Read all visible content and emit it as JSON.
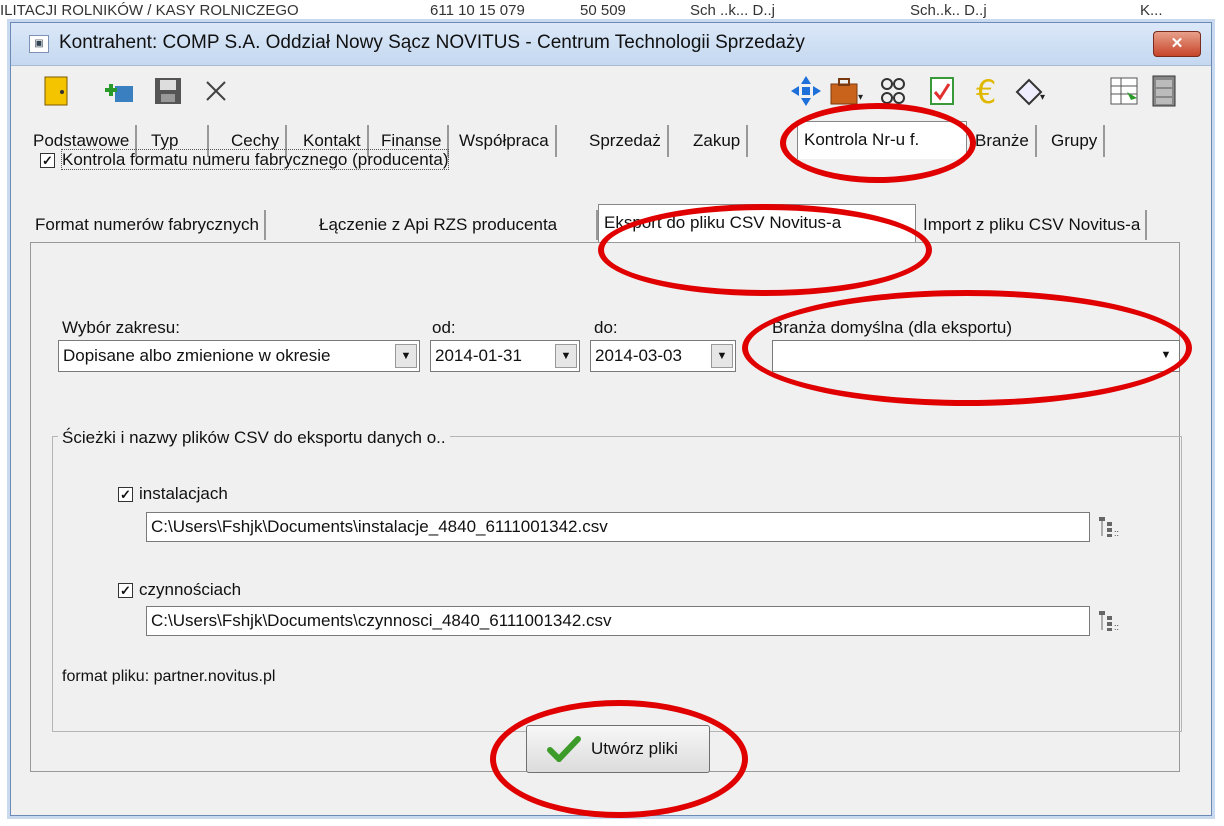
{
  "background": {
    "top_text": [
      "ILITACJI ROLNIKÓW / KASY ROLNICZEGO",
      "611 10 15 079",
      "50 509",
      "Sch ..k... D..j",
      "Sch..k.. D..j",
      "K..."
    ]
  },
  "window": {
    "title": "Kontrahent: COMP S.A. Oddział Nowy Sącz NOVITUS - Centrum Technologii Sprzedaży",
    "close_label": "✕"
  },
  "main_tabs": [
    "Podstawowe",
    "Typ",
    "Cechy",
    "Kontakt",
    "Finanse",
    "Współpraca",
    "Sprzedaż",
    "Zakup",
    "Kontrola Nr-u f.",
    "Branże",
    "Grupy"
  ],
  "active_main_tab": "Kontrola Nr-u f.",
  "format_check": {
    "checked": true,
    "label": "Kontrola formatu numeru fabrycznego (producenta)"
  },
  "sub_tabs": [
    "Format numerów fabrycznych",
    "Łączenie z Api RZS producenta",
    "Eksport do pliku CSV Novitus-a",
    "Import z pliku CSV Novitus-a"
  ],
  "active_sub_tab": "Eksport do pliku CSV Novitus-a",
  "range": {
    "label": "Wybór zakresu:",
    "value": "Dopisane albo zmienione w okresie",
    "from_label": "od:",
    "from_value": "2014-01-31",
    "to_label": "do:",
    "to_value": "2014-03-03",
    "branch_label": "Branża domyślna (dla eksportu)",
    "branch_value": ""
  },
  "paths_group": {
    "title": "Ścieżki i nazwy plików CSV do eksportu danych o..",
    "installations": {
      "checked": true,
      "label": "instalacjach",
      "path": "C:\\Users\\Fshjk\\Documents\\instalacje_4840_6111001342.csv"
    },
    "activities": {
      "checked": true,
      "label": "czynnościach",
      "path": "C:\\Users\\Fshjk\\Documents\\czynnosci_4840_6111001342.csv"
    }
  },
  "format_note": "format pliku: partner.novitus.pl",
  "create_button": "Utwórz pliki",
  "colors": {
    "annotation": "#e00000",
    "titlebar": "#c5d8f0",
    "close": "#c6442a"
  },
  "icons": [
    "door-icon",
    "add-icon",
    "save-icon",
    "delete-icon",
    "move-icon",
    "briefcase-icon",
    "people-icon",
    "checklist-icon",
    "euro-icon",
    "tag-icon",
    "table-icon",
    "cabinet-icon"
  ]
}
